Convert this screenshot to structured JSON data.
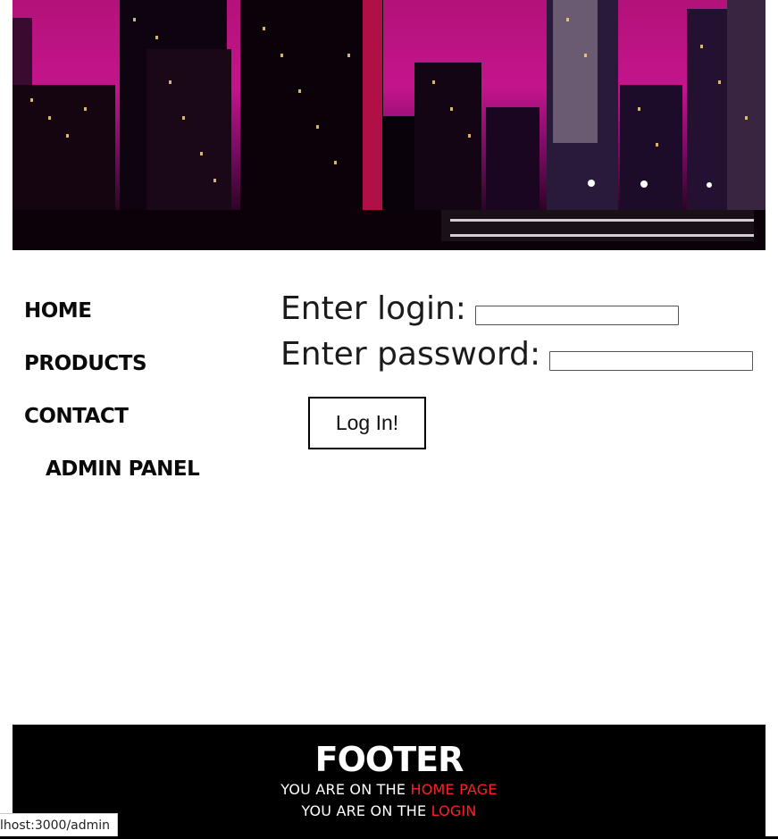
{
  "header": {
    "banner_image": "city-skyline-at-night"
  },
  "nav": {
    "items": [
      {
        "label": "HOME"
      },
      {
        "label": "PRODUCTS"
      },
      {
        "label": "CONTACT"
      },
      {
        "label": "ADMIN PANEL"
      }
    ]
  },
  "login_form": {
    "login_label": "Enter login:",
    "login_value": "",
    "password_label": "Enter password:",
    "password_value": "",
    "submit_label": "Log In!"
  },
  "footer": {
    "title": "FOOTER",
    "line1_prefix": "YOU ARE ON THE ",
    "line1_link": "HOME PAGE",
    "line2_prefix": "YOU ARE ON THE ",
    "line2_link": "LOGIN",
    "link_color": "#ff2020",
    "background": "#000000"
  },
  "status_bar": {
    "url": "lhost:3000/admin"
  }
}
